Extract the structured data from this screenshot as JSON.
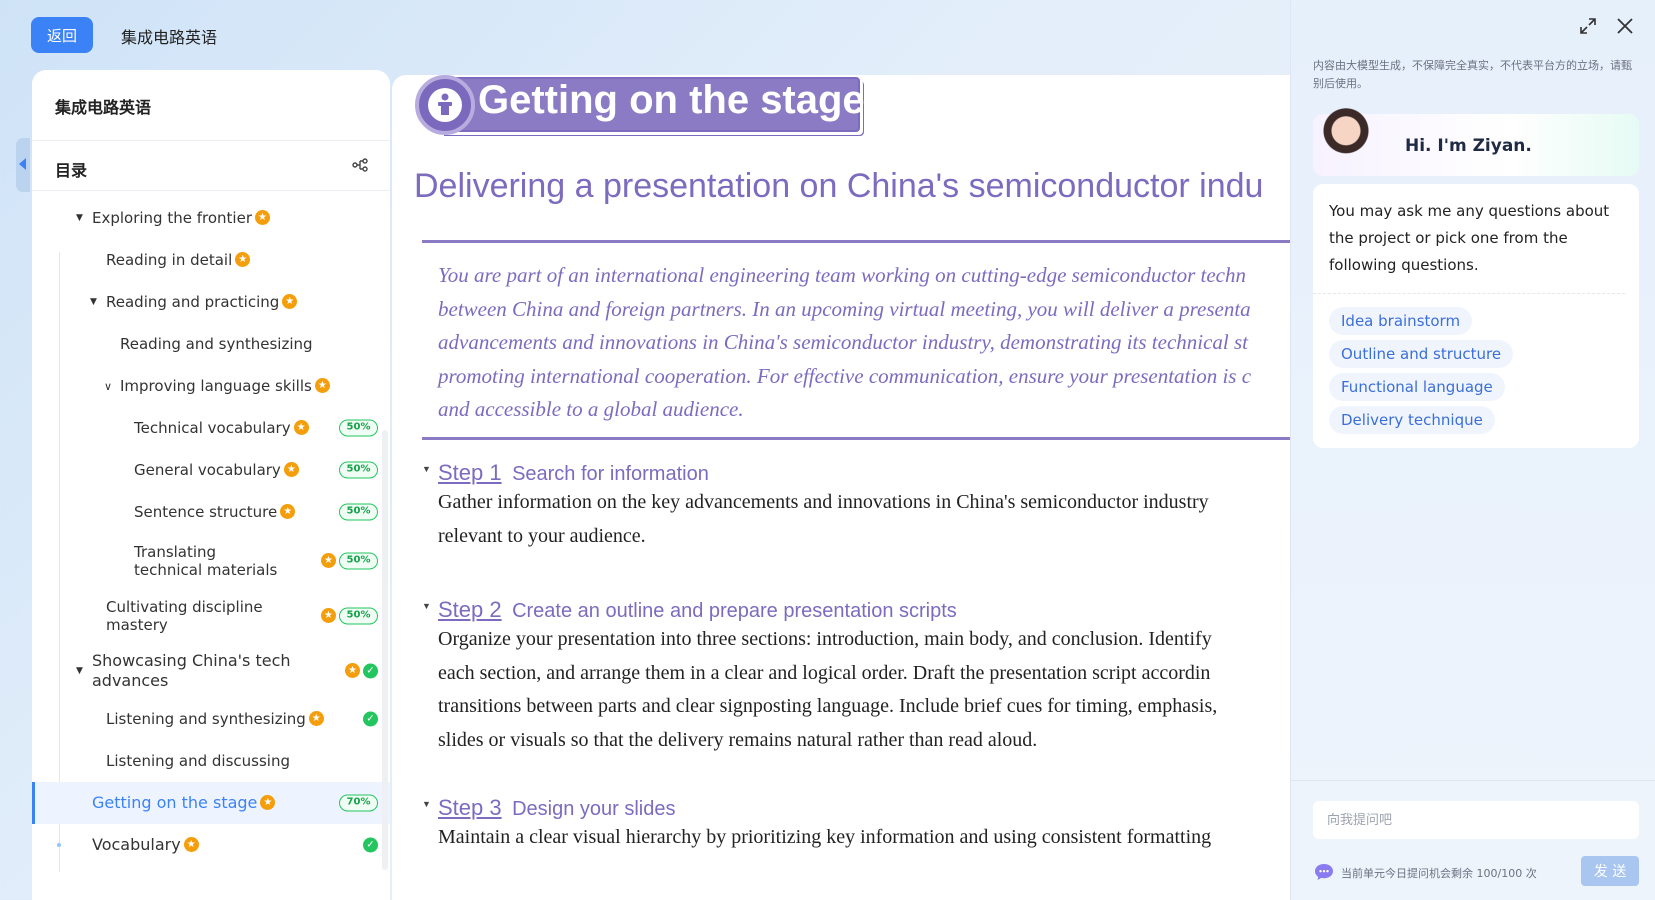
{
  "topbar": {
    "back_label": "返回",
    "title": "集成电路英语"
  },
  "sidebar": {
    "book_title": "集成电路英语",
    "toc_label": "目录",
    "items": [
      {
        "label": "Exploring the frontier",
        "star": true
      },
      {
        "label": "Reading in detail",
        "star": true
      },
      {
        "label": "Reading and practicing",
        "star": true
      },
      {
        "label": "Reading and synthesizing",
        "star": false
      },
      {
        "label": "Improving language skills",
        "star": true
      },
      {
        "label": "Technical vocabulary",
        "star": true,
        "progress": "50%"
      },
      {
        "label": "General vocabulary",
        "star": true,
        "progress": "50%"
      },
      {
        "label": "Sentence structure",
        "star": true,
        "progress": "50%"
      },
      {
        "label": "Translating technical materials",
        "star": true,
        "progress": "50%"
      },
      {
        "label": "Cultivating discipline mastery",
        "star": true,
        "progress": "50%"
      },
      {
        "label": "Showcasing China's tech advances",
        "star": true,
        "done": true
      },
      {
        "label": "Listening and synthesizing",
        "star": true,
        "done": true
      },
      {
        "label": "Listening and discussing",
        "star": false
      },
      {
        "label": "Getting on the stage",
        "star": true,
        "progress": "70%",
        "active": true
      },
      {
        "label": "Vocabulary",
        "star": true,
        "done": true
      }
    ]
  },
  "main": {
    "banner_title": "Getting on the stage",
    "subtitle": "Delivering a presentation on China's semiconductor indu",
    "scenario_lines": [
      "You are part of an international engineering team working on cutting-edge semiconductor techn",
      "between China and foreign partners. In an upcoming virtual meeting, you will deliver a presenta",
      "advancements and innovations in China's semiconductor industry, demonstrating its technical st",
      "promoting international cooperation. For effective communication, ensure your presentation is c",
      "and accessible to a global audience."
    ],
    "steps": [
      {
        "num": "Step 1",
        "title": "Search for information",
        "body": [
          "Gather information on the key advancements and innovations in China's semiconductor industry",
          "relevant to your audience."
        ]
      },
      {
        "num": "Step 2",
        "title": "Create an outline and prepare presentation scripts",
        "body": [
          "Organize your presentation into three sections: introduction, main body, and conclusion. Identify",
          "each section, and arrange them in a clear and logical order. Draft the presentation script accordin",
          "transitions between parts and clear signposting language. Include brief cues for timing, emphasis,",
          "slides or visuals so that the delivery remains natural rather than read aloud."
        ]
      },
      {
        "num": "Step 3",
        "title": "Design your slides",
        "body": [
          "Maintain a clear visual hierarchy by prioritizing key information and using consistent formatting"
        ]
      }
    ]
  },
  "assistant": {
    "disclaimer": "内容由大模型生成，不保障完全真实，不代表平台方的立场，请甄别后使用。",
    "greeting": "Hi. I'm Ziyan.",
    "intro": "You may ask me any questions about the project or pick one from the following questions.",
    "questions": [
      "Idea brainstorm",
      "Outline and structure",
      "Functional language",
      "Delivery technique"
    ],
    "input_placeholder": "向我提问吧",
    "quota": "当前单元今日提问机会剩余 100/100 次",
    "send_label": "发 送"
  }
}
